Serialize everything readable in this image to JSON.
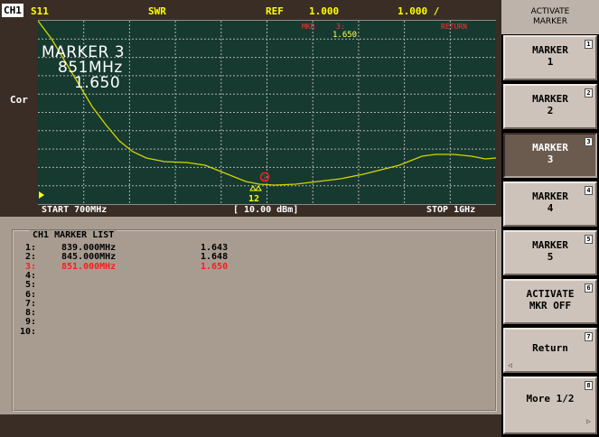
{
  "header": {
    "channel": "CH1",
    "param": "S11",
    "format": "SWR",
    "ref_label": "REF",
    "ref_value": "1.000",
    "scale": "1.000 /"
  },
  "graph": {
    "side_label": "Cor",
    "mkr_small_label": "MKR",
    "mkr_small_num": "3:",
    "mkr_small_value": "1.650",
    "return_label": "RETURN",
    "marker_title": "MARKER 3",
    "marker_freq": "851MHz",
    "marker_value": "1.650",
    "marker_tag": "3",
    "marker_cluster": "12",
    "trace_color": "#d4d400",
    "grid_color": "#b0b0b0"
  },
  "footer": {
    "start": "START 700MHz",
    "power": "[ 10.00 dBm]",
    "stop": "STOP 1GHz"
  },
  "marker_list": {
    "title": "CH1 MARKER LIST",
    "rows": [
      {
        "n": "1:",
        "freq": "839.000MHz",
        "value": "1.643"
      },
      {
        "n": "2:",
        "freq": "845.000MHz",
        "value": "1.648"
      },
      {
        "n": "3:",
        "freq": "851.000MHz",
        "value": "1.650"
      },
      {
        "n": "4:",
        "freq": "",
        "value": ""
      },
      {
        "n": "5:",
        "freq": "",
        "value": ""
      },
      {
        "n": "6:",
        "freq": "",
        "value": ""
      },
      {
        "n": "7:",
        "freq": "",
        "value": ""
      },
      {
        "n": "8:",
        "freq": "",
        "value": ""
      },
      {
        "n": "9:",
        "freq": "",
        "value": ""
      },
      {
        "n": "10:",
        "freq": "",
        "value": ""
      }
    ],
    "active_color": "#ff1a1a"
  },
  "softkeys": {
    "title_line1": "ACTIVATE",
    "title_line2": "MARKER",
    "keys": [
      {
        "label": "MARKER\n1",
        "num": "1"
      },
      {
        "label": "MARKER\n2",
        "num": "2"
      },
      {
        "label": "MARKER\n3",
        "num": "3"
      },
      {
        "label": "MARKER\n4",
        "num": "4"
      },
      {
        "label": "MARKER\n5",
        "num": "5"
      },
      {
        "label": "ACTIVATE\nMKR OFF",
        "num": "6"
      },
      {
        "label": "Return",
        "num": "7"
      },
      {
        "label": "More 1/2",
        "num": "8"
      }
    ]
  }
}
